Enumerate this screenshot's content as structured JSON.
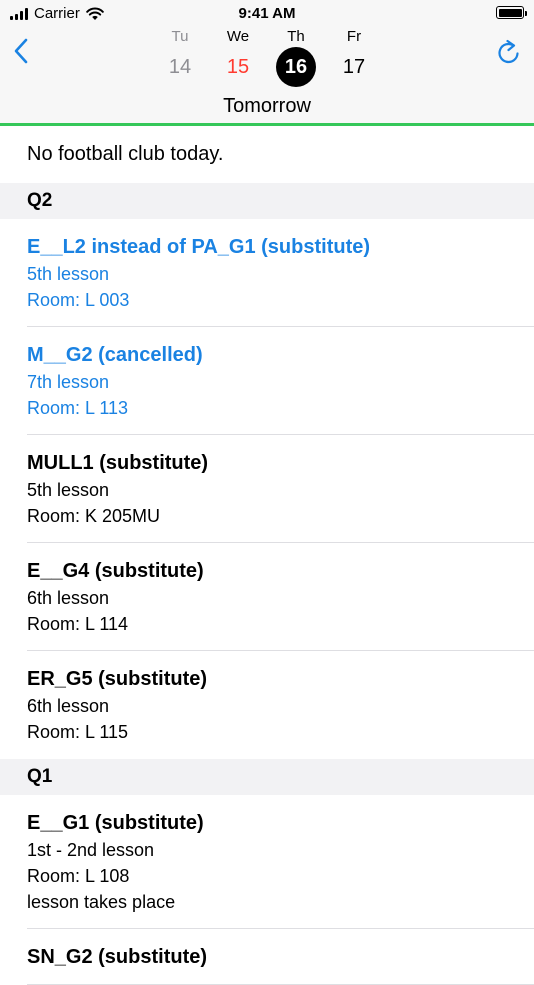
{
  "status": {
    "carrier": "Carrier",
    "time": "9:41 AM"
  },
  "nav": {
    "back_icon": "chevron-left-icon",
    "refresh_icon": "refresh-icon",
    "days": [
      {
        "weekday": "Tu",
        "date": "14"
      },
      {
        "weekday": "We",
        "date": "15"
      },
      {
        "weekday": "Th",
        "date": "16"
      },
      {
        "weekday": "Fr",
        "date": "17"
      }
    ],
    "title": "Tomorrow"
  },
  "colors": {
    "accent": "#1a82e2",
    "today": "#ff3b30",
    "divider": "#35c759",
    "section_bg": "#f2f2f4"
  },
  "notice": "No football club today.",
  "sections": [
    {
      "name": "Q2",
      "entries": [
        {
          "title": "E__L2 instead of PA_G1 (substitute)",
          "lesson": "5th lesson",
          "room": "Room: L 003"
        },
        {
          "title": "M__G2 (cancelled)",
          "lesson": "7th lesson",
          "room": "Room: L 113"
        },
        {
          "title": "MULL1 (substitute)",
          "lesson": "5th lesson",
          "room": "Room: K 205MU"
        },
        {
          "title": "E__G4 (substitute)",
          "lesson": "6th lesson",
          "room": "Room: L 114"
        },
        {
          "title": "ER_G5 (substitute)",
          "lesson": "6th lesson",
          "room": "Room: L 115"
        }
      ]
    },
    {
      "name": "Q1",
      "entries": [
        {
          "title": "E__G1 (substitute)",
          "lesson": "1st - 2nd lesson",
          "room": "Room: L 108",
          "note": "lesson takes place"
        },
        {
          "title": "SN_G2 (substitute)"
        }
      ]
    }
  ]
}
